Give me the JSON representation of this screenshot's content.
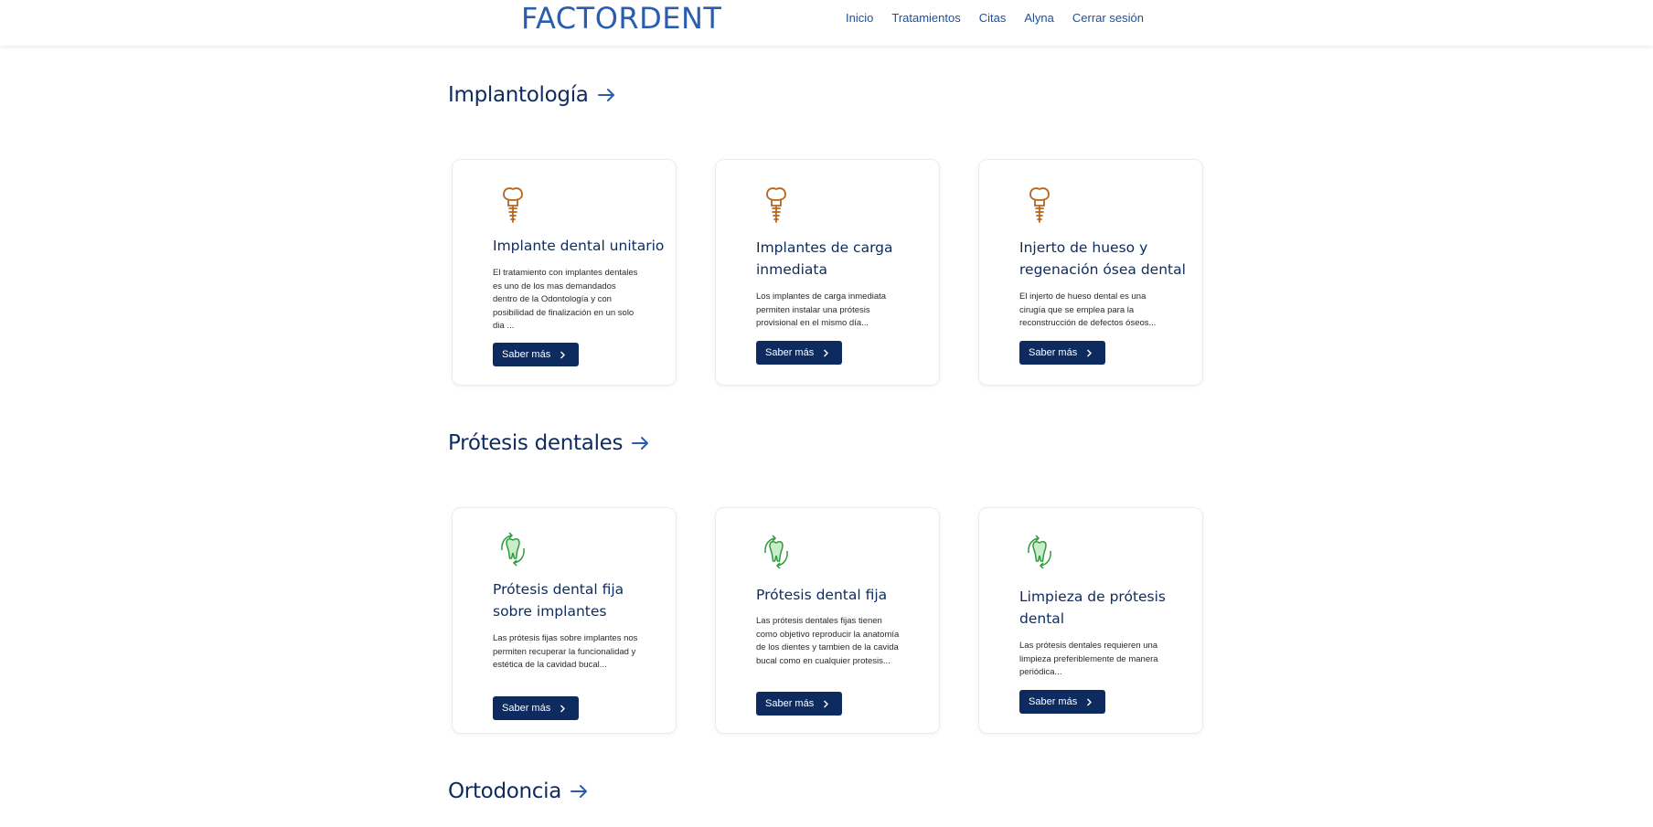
{
  "header": {
    "logo": "FACTORDENT",
    "nav": [
      "Inicio",
      "Tratamientos",
      "Citas",
      "Alyna",
      "Cerrar sesión"
    ]
  },
  "colors": {
    "brand_dark": "#0d2b5e",
    "brand_blue": "#2a5db0",
    "implant_icon": "#b8651f",
    "prosthesis_icon": "#2e9a3a"
  },
  "sections": [
    {
      "title": "Implantología",
      "icon": "dental-implant-icon",
      "cards": [
        {
          "title": "Implante dental unitario",
          "description": "El tratamiento con implantes dentales es uno de los mas demandados dentro de la Odontología y con posibilidad de finalización en un solo dia ...",
          "button": "Saber más"
        },
        {
          "title": "Implantes de carga inmediata",
          "description": "Los implantes de carga inmediata permiten instalar una prótesis provisional en el mismo día...",
          "button": "Saber más"
        },
        {
          "title": "Injerto de hueso y regenación ósea dental",
          "description": "El injerto de hueso dental es una cirugía que se emplea para la reconstrucción de defectos óseos...",
          "button": "Saber más"
        }
      ]
    },
    {
      "title": "Prótesis dentales",
      "icon": "tooth-cycle-icon",
      "cards": [
        {
          "title": "Prótesis dental fija sobre implantes",
          "description": "Las prótesis fijas sobre implantes nos permiten recuperar la funcionalidad y estética de la cavidad bucal...",
          "button": "Saber más"
        },
        {
          "title": "Prótesis dental fija",
          "description": "Las prótesis dentales fijas tienen como objetivo reproducir la anatomía de los dientes y tambien de la cavida bucal como en cualquier protesis...",
          "button": "Saber más"
        },
        {
          "title": "Limpieza de prótesis dental",
          "description": "Las prótesis dentales requieren una limpieza preferiblemente de manera periódica...",
          "button": "Saber más"
        }
      ]
    },
    {
      "title": "Ortodoncia"
    }
  ]
}
